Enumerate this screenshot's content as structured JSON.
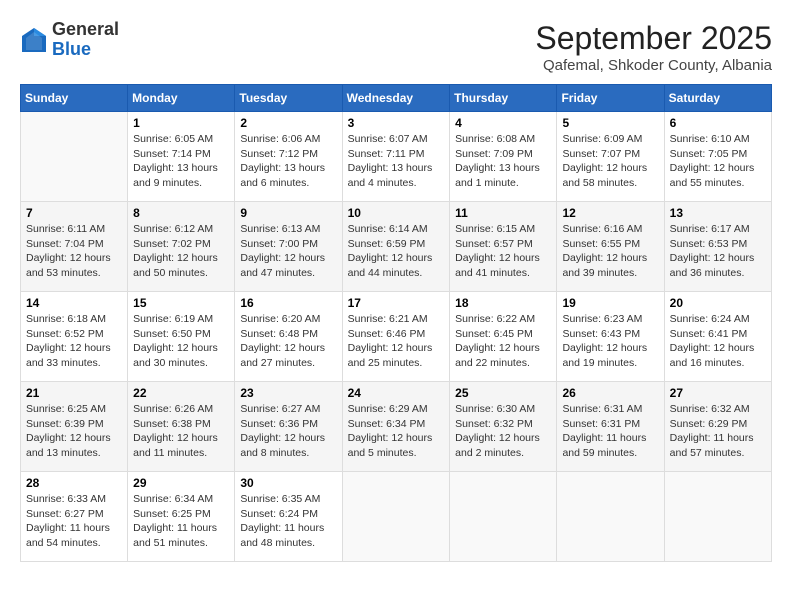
{
  "logo": {
    "general": "General",
    "blue": "Blue"
  },
  "header": {
    "month": "September 2025",
    "location": "Qafemal, Shkoder County, Albania"
  },
  "days_of_week": [
    "Sunday",
    "Monday",
    "Tuesday",
    "Wednesday",
    "Thursday",
    "Friday",
    "Saturday"
  ],
  "weeks": [
    [
      {
        "day": "",
        "info": ""
      },
      {
        "day": "1",
        "info": "Sunrise: 6:05 AM\nSunset: 7:14 PM\nDaylight: 13 hours\nand 9 minutes."
      },
      {
        "day": "2",
        "info": "Sunrise: 6:06 AM\nSunset: 7:12 PM\nDaylight: 13 hours\nand 6 minutes."
      },
      {
        "day": "3",
        "info": "Sunrise: 6:07 AM\nSunset: 7:11 PM\nDaylight: 13 hours\nand 4 minutes."
      },
      {
        "day": "4",
        "info": "Sunrise: 6:08 AM\nSunset: 7:09 PM\nDaylight: 13 hours\nand 1 minute."
      },
      {
        "day": "5",
        "info": "Sunrise: 6:09 AM\nSunset: 7:07 PM\nDaylight: 12 hours\nand 58 minutes."
      },
      {
        "day": "6",
        "info": "Sunrise: 6:10 AM\nSunset: 7:05 PM\nDaylight: 12 hours\nand 55 minutes."
      }
    ],
    [
      {
        "day": "7",
        "info": "Sunrise: 6:11 AM\nSunset: 7:04 PM\nDaylight: 12 hours\nand 53 minutes."
      },
      {
        "day": "8",
        "info": "Sunrise: 6:12 AM\nSunset: 7:02 PM\nDaylight: 12 hours\nand 50 minutes."
      },
      {
        "day": "9",
        "info": "Sunrise: 6:13 AM\nSunset: 7:00 PM\nDaylight: 12 hours\nand 47 minutes."
      },
      {
        "day": "10",
        "info": "Sunrise: 6:14 AM\nSunset: 6:59 PM\nDaylight: 12 hours\nand 44 minutes."
      },
      {
        "day": "11",
        "info": "Sunrise: 6:15 AM\nSunset: 6:57 PM\nDaylight: 12 hours\nand 41 minutes."
      },
      {
        "day": "12",
        "info": "Sunrise: 6:16 AM\nSunset: 6:55 PM\nDaylight: 12 hours\nand 39 minutes."
      },
      {
        "day": "13",
        "info": "Sunrise: 6:17 AM\nSunset: 6:53 PM\nDaylight: 12 hours\nand 36 minutes."
      }
    ],
    [
      {
        "day": "14",
        "info": "Sunrise: 6:18 AM\nSunset: 6:52 PM\nDaylight: 12 hours\nand 33 minutes."
      },
      {
        "day": "15",
        "info": "Sunrise: 6:19 AM\nSunset: 6:50 PM\nDaylight: 12 hours\nand 30 minutes."
      },
      {
        "day": "16",
        "info": "Sunrise: 6:20 AM\nSunset: 6:48 PM\nDaylight: 12 hours\nand 27 minutes."
      },
      {
        "day": "17",
        "info": "Sunrise: 6:21 AM\nSunset: 6:46 PM\nDaylight: 12 hours\nand 25 minutes."
      },
      {
        "day": "18",
        "info": "Sunrise: 6:22 AM\nSunset: 6:45 PM\nDaylight: 12 hours\nand 22 minutes."
      },
      {
        "day": "19",
        "info": "Sunrise: 6:23 AM\nSunset: 6:43 PM\nDaylight: 12 hours\nand 19 minutes."
      },
      {
        "day": "20",
        "info": "Sunrise: 6:24 AM\nSunset: 6:41 PM\nDaylight: 12 hours\nand 16 minutes."
      }
    ],
    [
      {
        "day": "21",
        "info": "Sunrise: 6:25 AM\nSunset: 6:39 PM\nDaylight: 12 hours\nand 13 minutes."
      },
      {
        "day": "22",
        "info": "Sunrise: 6:26 AM\nSunset: 6:38 PM\nDaylight: 12 hours\nand 11 minutes."
      },
      {
        "day": "23",
        "info": "Sunrise: 6:27 AM\nSunset: 6:36 PM\nDaylight: 12 hours\nand 8 minutes."
      },
      {
        "day": "24",
        "info": "Sunrise: 6:29 AM\nSunset: 6:34 PM\nDaylight: 12 hours\nand 5 minutes."
      },
      {
        "day": "25",
        "info": "Sunrise: 6:30 AM\nSunset: 6:32 PM\nDaylight: 12 hours\nand 2 minutes."
      },
      {
        "day": "26",
        "info": "Sunrise: 6:31 AM\nSunset: 6:31 PM\nDaylight: 11 hours\nand 59 minutes."
      },
      {
        "day": "27",
        "info": "Sunrise: 6:32 AM\nSunset: 6:29 PM\nDaylight: 11 hours\nand 57 minutes."
      }
    ],
    [
      {
        "day": "28",
        "info": "Sunrise: 6:33 AM\nSunset: 6:27 PM\nDaylight: 11 hours\nand 54 minutes."
      },
      {
        "day": "29",
        "info": "Sunrise: 6:34 AM\nSunset: 6:25 PM\nDaylight: 11 hours\nand 51 minutes."
      },
      {
        "day": "30",
        "info": "Sunrise: 6:35 AM\nSunset: 6:24 PM\nDaylight: 11 hours\nand 48 minutes."
      },
      {
        "day": "",
        "info": ""
      },
      {
        "day": "",
        "info": ""
      },
      {
        "day": "",
        "info": ""
      },
      {
        "day": "",
        "info": ""
      }
    ]
  ]
}
